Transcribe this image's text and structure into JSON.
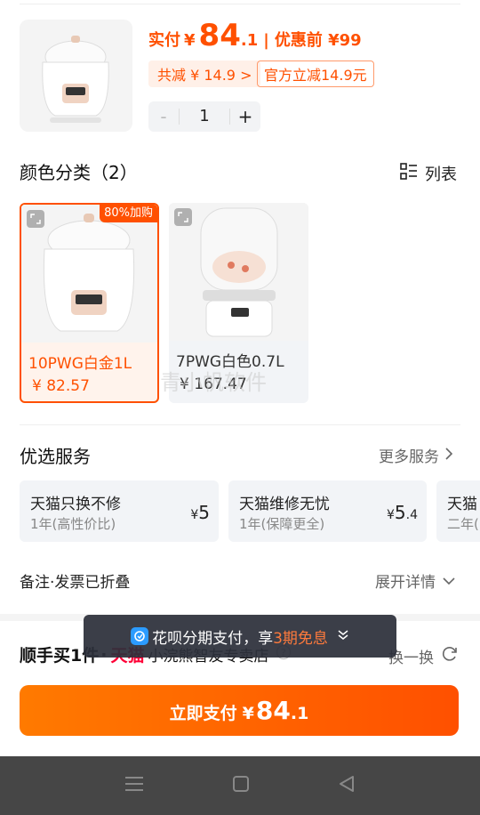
{
  "product": {
    "pay_label": "实付",
    "currency": "¥",
    "price_int": "84",
    "price_dec": ".1",
    "separator": "|",
    "original_label": "优惠前 ¥99",
    "save_tag": "共减 ¥ 14.9 >",
    "official_tag": "官方立减14.9元",
    "quantity": "1",
    "minus": "-",
    "plus": "+"
  },
  "color_section": {
    "title": "颜色分类（2）",
    "list_label": "列表",
    "options": [
      {
        "name": "10PWG白金1L",
        "price": "¥ 82.57",
        "badge": "80%加购",
        "selected": true
      },
      {
        "name": "7PWG白色0.7L",
        "price": "¥ 167.47",
        "selected": false
      }
    ],
    "watermark": "青小帆软件"
  },
  "services": {
    "title": "优选服务",
    "more_label": "更多服务",
    "items": [
      {
        "name": "天猫只换不修",
        "desc": "1年(高性价比)",
        "currency": "¥",
        "price": "5",
        "price_dec": ""
      },
      {
        "name": "天猫维修无忧",
        "desc": "1年(保障更全)",
        "currency": "¥",
        "price": "5",
        "price_dec": ".4"
      },
      {
        "name": "天猫",
        "desc": "二年(",
        "currency": "",
        "price": "",
        "price_dec": ""
      }
    ]
  },
  "remarks": {
    "label": "备注·发票已折叠",
    "expand_label": "展开详情"
  },
  "promo": {
    "title": "顺手买1件",
    "dot": "·",
    "tmall": "天猫",
    "shop": "小浣熊智友专卖店",
    "swap_label": "换一换"
  },
  "toast": {
    "prefix": "花呗分期支付，享",
    "highlight": "3期免息"
  },
  "pay_button": {
    "label": "立即支付",
    "currency": "¥",
    "price_int": "84",
    "price_dec": ".1"
  },
  "colors": {
    "accent": "#ff5000",
    "tmall_red": "#ff0036",
    "nav_bar": "#464646"
  },
  "icons": [
    "zoom-icon",
    "list-icon",
    "chevron-right-icon",
    "chevron-down-icon",
    "refresh-icon",
    "huabei-icon",
    "menu-icon",
    "home-icon",
    "back-icon",
    "help-icon"
  ]
}
